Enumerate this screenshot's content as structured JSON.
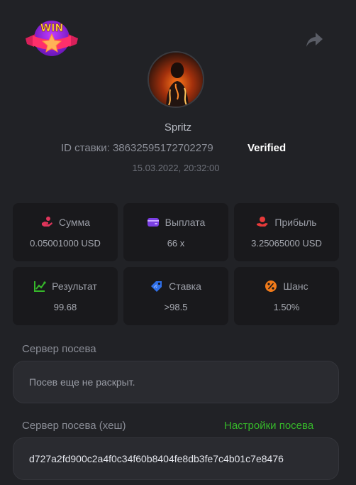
{
  "header": {
    "logo_text": "WIN",
    "logo_icon": "win-star-logo",
    "share_icon": "share-arrow-icon"
  },
  "user": {
    "avatar_icon": "fiery-figure-avatar",
    "name": "Spritz"
  },
  "bet": {
    "id_text": "ID ставки: 38632595172702279",
    "verified": "Verified",
    "datetime": "15.03.2022, 20:32:00"
  },
  "stats": [
    {
      "label": "Сумма",
      "value": "0.05001000 USD",
      "icon": "coins-hand-icon",
      "color": "#e0355b"
    },
    {
      "label": "Выплата",
      "value": "66 x",
      "icon": "wallet-icon",
      "color": "#7b3fe4"
    },
    {
      "label": "Прибыль",
      "value": "3.25065000 USD",
      "icon": "profit-hand-icon",
      "color": "#e63a3a"
    },
    {
      "label": "Результат",
      "value": "99.68",
      "icon": "chart-line-icon",
      "color": "#36b82a"
    },
    {
      "label": "Ставка",
      "value": ">98.5",
      "icon": "tag-icon",
      "color": "#2f6fe8"
    },
    {
      "label": "Шанс",
      "value": "1.50%",
      "icon": "percent-icon",
      "color": "#f07a1a"
    }
  ],
  "seed": {
    "server_label": "Сервер посева",
    "server_value": "Посев еще не раскрыт.",
    "hash_label": "Сервер посева (хеш)",
    "settings_link": "Настройки посева",
    "hash_value": "d727a2fd900c2a4f0c34f60b8404fe8db3fe7c4b01c7e8476"
  },
  "colors": {
    "accent_green": "#36b82a",
    "background": "#212226",
    "card": "#19191c"
  }
}
